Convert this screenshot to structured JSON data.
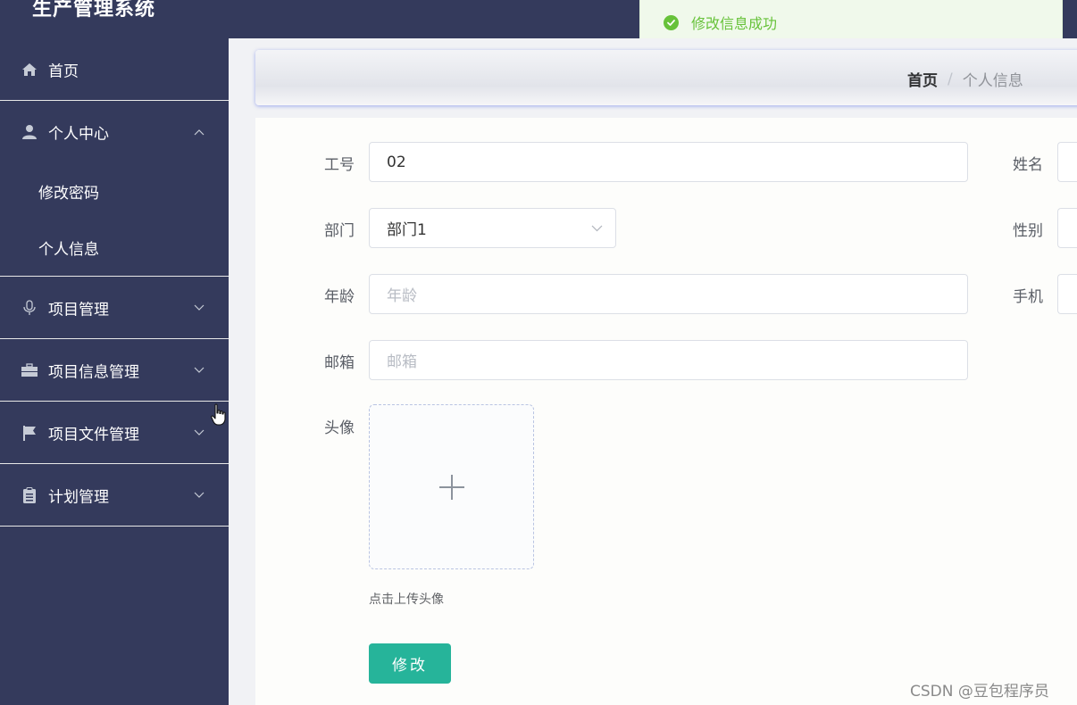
{
  "app": {
    "title": "生产管理系统"
  },
  "toast": {
    "message": "修改信息成功",
    "color": "#67c23a"
  },
  "sidebar": {
    "items": [
      {
        "label": "首页",
        "icon": "home-icon"
      },
      {
        "label": "个人中心",
        "icon": "user-icon",
        "expanded": true,
        "children": [
          {
            "label": "修改密码"
          },
          {
            "label": "个人信息"
          }
        ]
      },
      {
        "label": "项目管理",
        "icon": "microphone-icon"
      },
      {
        "label": "项目信息管理",
        "icon": "briefcase-icon"
      },
      {
        "label": "项目文件管理",
        "icon": "flag-icon"
      },
      {
        "label": "计划管理",
        "icon": "clipboard-icon"
      }
    ]
  },
  "breadcrumb": {
    "home": "首页",
    "separator": "/",
    "current": "个人信息"
  },
  "form": {
    "employee_id": {
      "label": "工号",
      "value": "02"
    },
    "name": {
      "label": "姓名"
    },
    "department": {
      "label": "部门",
      "value": "部门1"
    },
    "gender": {
      "label": "性别"
    },
    "age": {
      "label": "年龄",
      "placeholder": "年龄"
    },
    "phone": {
      "label": "手机"
    },
    "email": {
      "label": "邮箱",
      "placeholder": "邮箱"
    },
    "avatar": {
      "label": "头像",
      "tip": "点击上传头像"
    },
    "submit_label": "修改"
  },
  "watermark": "CSDN @豆包程序员",
  "colors": {
    "sidebar_bg": "#343a5c",
    "accent": "#26b49a"
  }
}
